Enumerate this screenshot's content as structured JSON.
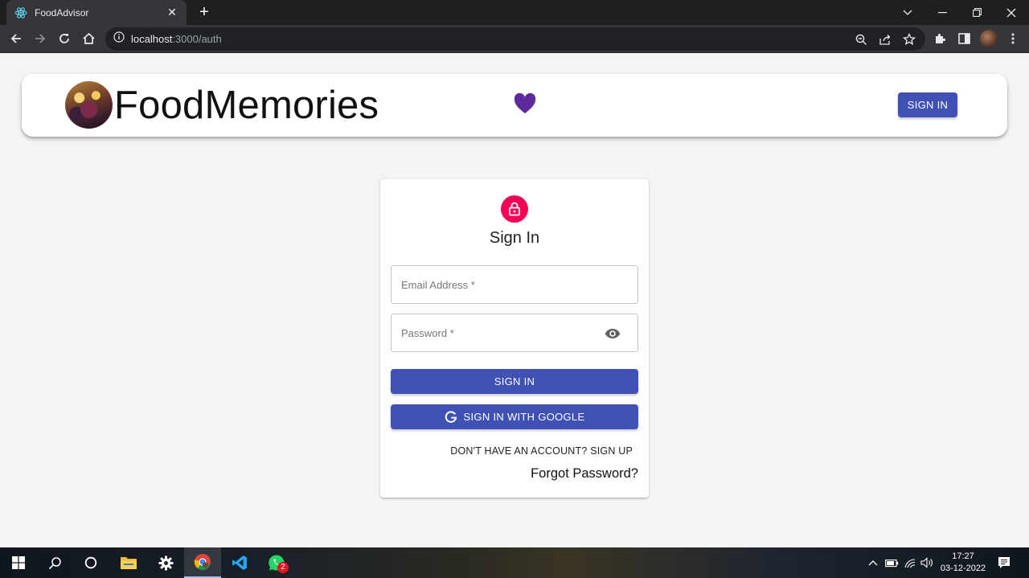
{
  "browser": {
    "tab_title": "FoodAdvisor",
    "tab_close": "✕",
    "new_tab": "+",
    "url_host": "localhost",
    "url_path": ":3000/auth"
  },
  "header": {
    "brand": "FoodMemories",
    "signin_label": "SIGN IN",
    "heart_color": "#5e2a9b",
    "accent": "#3f51b5"
  },
  "signin_card": {
    "title": "Sign In",
    "email_placeholder": "Email Address *",
    "password_placeholder": "Password *",
    "signin_label": "SIGN IN",
    "google_label": "SIGN IN WITH GOOGLE",
    "signup_link": "DON'T HAVE AN ACCOUNT? SIGN UP",
    "forgot_link": "Forgot Password?",
    "lock_color": "#f50057"
  },
  "taskbar": {
    "time": "17:27",
    "date": "03-12-2022",
    "whatsapp_badge": "2"
  }
}
